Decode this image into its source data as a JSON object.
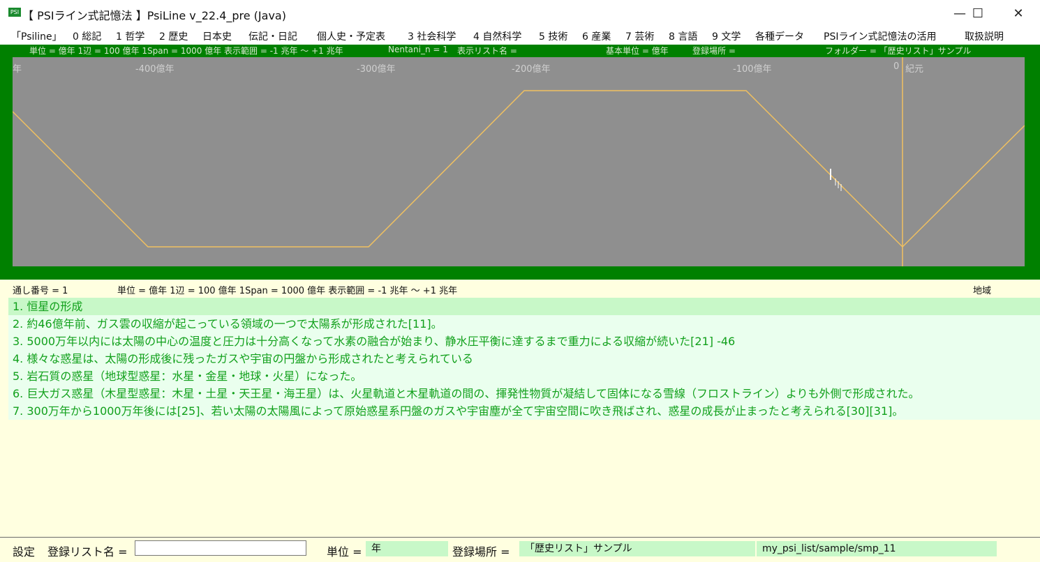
{
  "window": {
    "icon_text": "PSI",
    "title": "【 PSIライン式記憶法 】PsiLine v_22.4_pre (Java)",
    "minimize": "—",
    "maximize": "☐",
    "close": "✕"
  },
  "menu": [
    "「Psiline」",
    "0 総記",
    "1 哲学",
    "2 歴史",
    "日本史",
    "伝記・日記",
    "個人史・予定表",
    "3 社会科学",
    "4 自然科学",
    "5 技術",
    "6 産業",
    "7 芸術",
    "8 言語",
    "9 文学",
    "各種データ",
    "PSIライン式記憶法の活用",
    "取扱説明"
  ],
  "status_top": {
    "unit_info": "単位 = 億年  1辺 = 100 億年  1Span = 1000 億年  表示範囲 = -1 兆年 〜 +1 兆年",
    "nentani": "Nentani_n = 1",
    "list_name": "表示リスト名 =",
    "base_unit": "基本単位 = 億年",
    "location": "登録場所 =",
    "folder": "フォルダー = 「歴史リスト」サンプル"
  },
  "plot": {
    "tick_labels": [
      "年",
      "-400億年",
      "-300億年",
      "-200億年",
      "-100億年",
      "0",
      "紀元"
    ],
    "line_color": "#f0c060",
    "marker_color": "#ffffff"
  },
  "info_row": {
    "serial": "通し番号 = 1",
    "unit_info": "単位 = 億年  1辺 = 100 億年  1Span = 1000 億年  表示範囲 = -1 兆年 〜 +1 兆年",
    "region": "地域"
  },
  "items": [
    "1. 恒星の形成",
    "2. 約46億年前、ガス雲の収縮が起こっている領域の一つで太陽系が形成された[11]。",
    "3. 5000万年以内には太陽の中心の温度と圧力は十分高くなって水素の融合が始まり、静水圧平衡に達するまで重力による収縮が続いた[21] -46",
    "4. 様々な惑星は、太陽の形成後に残ったガスや宇宙の円盤から形成されたと考えられている",
    "5. 岩石質の惑星（地球型惑星：水星・金星・地球・火星）になった。",
    "6. 巨大ガス惑星（木星型惑星：木星・土星・天王星・海王星）は、火星軌道と木星軌道の間の、揮発性物質が凝結して固体になる雪線（フロストライン）よりも外側で形成された。",
    "7. 300万年から1000万年後には[25]、若い太陽の太陽風によって原始惑星系円盤のガスや宇宙塵が全て宇宙空間に吹き飛ばされ、惑星の成長が止まったと考えられる[30][31]。"
  ],
  "bottom": {
    "settings": "設定",
    "list_name_label": "登録リスト名 =",
    "list_name_value": "",
    "unit_label": "単位 =",
    "unit_value": "年",
    "location_label": "登録場所 =",
    "location_value": "「歴史リスト」サンプル",
    "path": "my_psi_list/sample/smp_11"
  }
}
